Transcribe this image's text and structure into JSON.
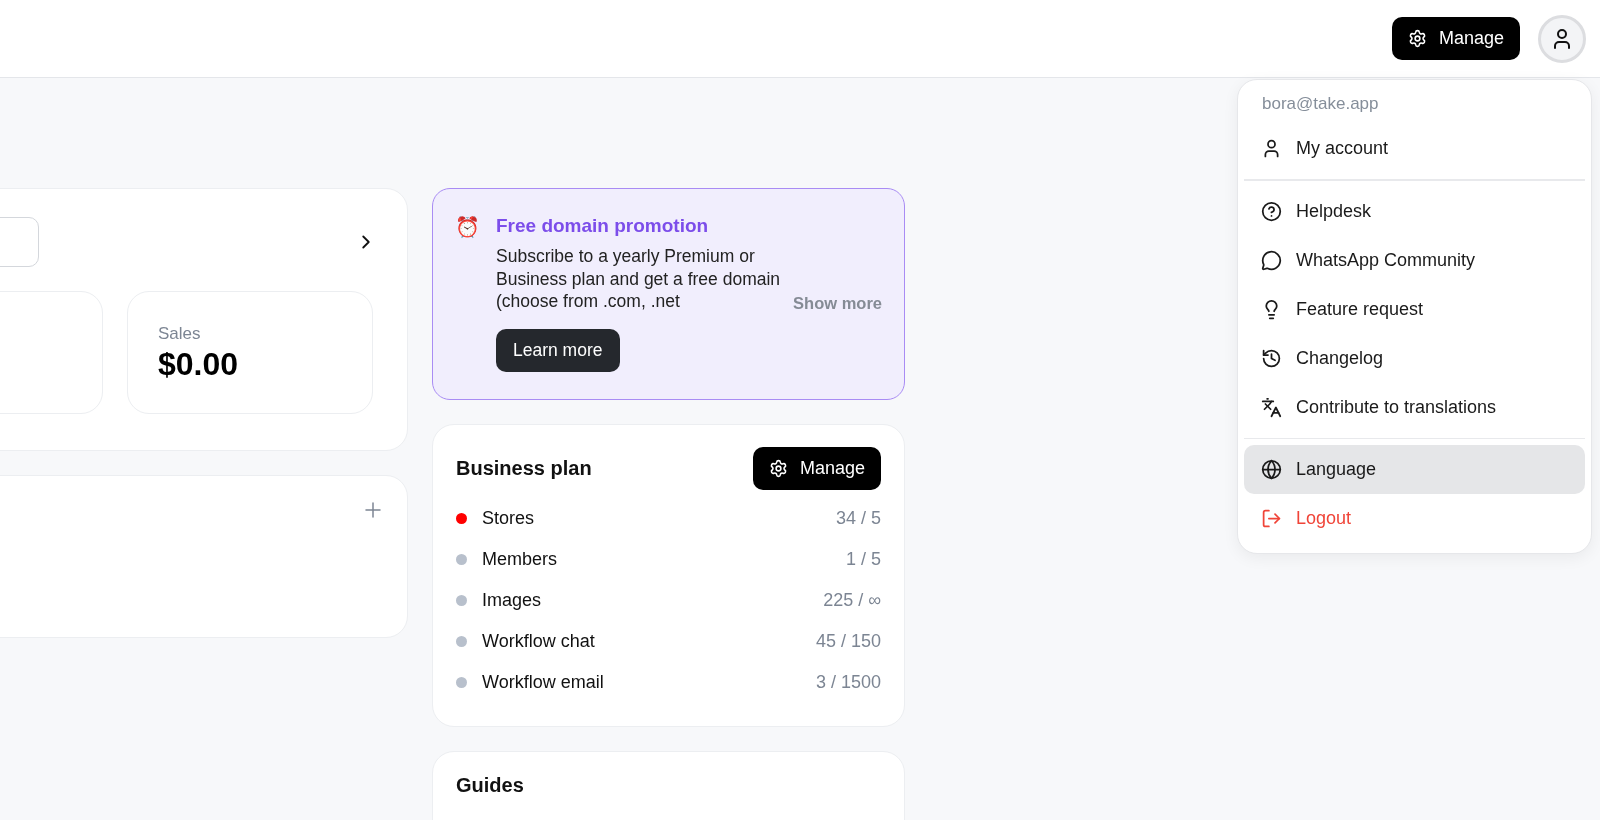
{
  "header": {
    "manage_button": "Manage"
  },
  "overview": {
    "stats": [
      {
        "label": "Sales",
        "value": "$0.00"
      }
    ]
  },
  "promotion": {
    "icon": "⏰",
    "title": "Free domain promotion",
    "body": "Subscribe to a yearly Premium or Business plan and get a free domain (choose from .com, .net",
    "show_more": "Show more",
    "button": "Learn more"
  },
  "plan": {
    "title": "Business plan",
    "manage_button": "Manage",
    "usage": [
      {
        "name": "Stores",
        "value": "34 / 5",
        "color": "#ff0000"
      },
      {
        "name": "Members",
        "value": "1 / 5",
        "color": "#b8c0cc"
      },
      {
        "name": "Images",
        "value": "225 / ∞",
        "color": "#b8c0cc"
      },
      {
        "name": "Workflow chat",
        "value": "45 / 150",
        "color": "#b8c0cc"
      },
      {
        "name": "Workflow email",
        "value": "3 / 1500",
        "color": "#b8c0cc"
      }
    ]
  },
  "guides": {
    "title": "Guides"
  },
  "account_menu": {
    "email": "bora@take.app",
    "groups": [
      {
        "items": [
          {
            "label": "My account",
            "kind": "normal",
            "selected": false
          }
        ]
      },
      {
        "items": [
          {
            "label": "Helpdesk",
            "kind": "normal",
            "selected": false
          },
          {
            "label": "WhatsApp Community",
            "kind": "normal",
            "selected": false
          },
          {
            "label": "Feature request",
            "kind": "normal",
            "selected": false
          },
          {
            "label": "Changelog",
            "kind": "normal",
            "selected": false
          },
          {
            "label": "Contribute to translations",
            "kind": "normal",
            "selected": false
          }
        ]
      },
      {
        "items": [
          {
            "label": "Language",
            "kind": "normal",
            "selected": true
          },
          {
            "label": "Logout",
            "kind": "danger",
            "selected": false
          }
        ]
      }
    ]
  }
}
